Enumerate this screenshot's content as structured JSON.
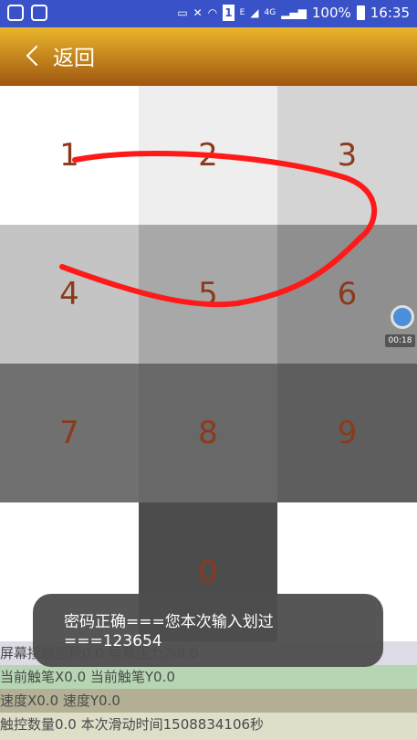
{
  "status_bar": {
    "battery_percent": "100%",
    "time": "16:35",
    "sim_badge": "1",
    "network": "4G",
    "e_label": "E"
  },
  "toolbar": {
    "back_label": "返回"
  },
  "keypad": {
    "keys": [
      "1",
      "2",
      "3",
      "4",
      "5",
      "6",
      "7",
      "8",
      "9",
      "0"
    ],
    "colors": {
      "1": "#ffffff",
      "2": "#eeeeee",
      "3": "#d4d4d4",
      "4": "#c4c4c4",
      "5": "#a8a8a8",
      "6": "#8f8f8f",
      "7": "#707070",
      "8": "#686868",
      "9": "#5e5e5e",
      "0": "#4c4c4c"
    },
    "stroke_color": "#ff1a1a",
    "digit_color": "#8b3a1b"
  },
  "recorder": {
    "time": "00:18"
  },
  "info_rows": [
    {
      "text": "屏幕接触面积0.0   屏幕压力为0.0",
      "bg": "#dddbe6"
    },
    {
      "text": "当前触笔X0.0   当前触笔Y0.0",
      "bg": "#b6d5b3"
    },
    {
      "text": "速度X0.0   速度Y0.0",
      "bg": "#b4b096"
    },
    {
      "text": "触控数量0.0   本次滑动时间1508834106秒",
      "bg": "#dedec9"
    }
  ],
  "toast": {
    "line1": "密码正确===您本次输入划过",
    "line2": "===123654"
  }
}
